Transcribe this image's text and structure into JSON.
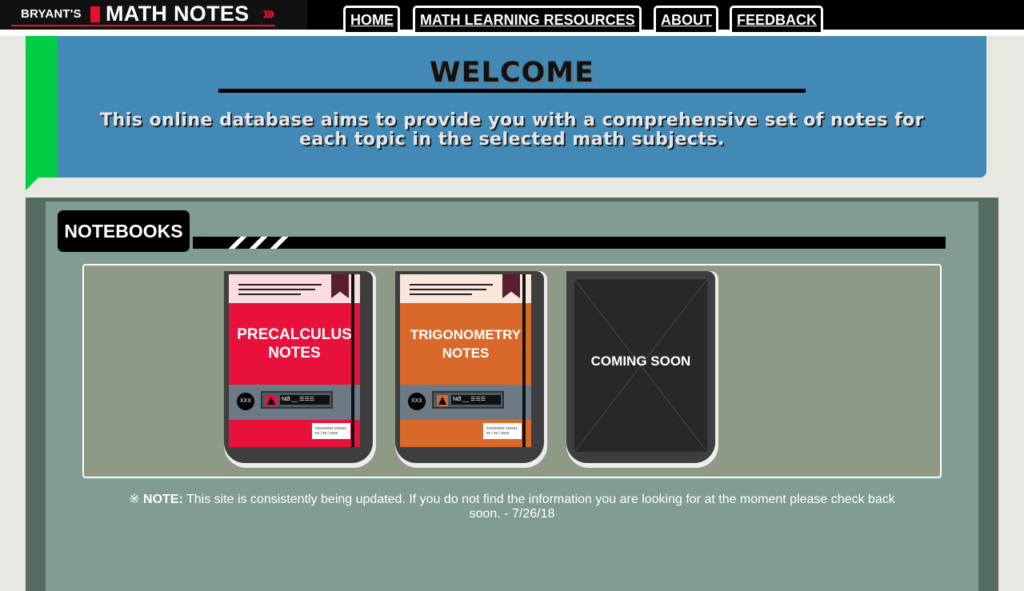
{
  "logo": {
    "prefix": "BRYANT'S",
    "name": "MATH NOTES",
    "chevrons": "›››"
  },
  "nav": [
    {
      "label": "HOME"
    },
    {
      "label": "MATH LEARNING RESOURCES"
    },
    {
      "label": "ABOUT"
    },
    {
      "label": "FEEDBACK"
    }
  ],
  "welcome": {
    "title": "WELCOME",
    "text": "This online database aims to provide you with a comprehensive set of notes for each topic in the selected math subjects."
  },
  "notebooks": {
    "heading": "NOTEBOOKS",
    "books": [
      {
        "title_line1": "PRECALCULUS",
        "title_line2": "NOTES",
        "color": "#e8113b",
        "band_color": "#fbdde1",
        "tag_text": "NØ.__ ☰☰☰",
        "circle_text": "XXX",
        "sticker_text": "xxxxxxxxx xxxxxx xx / xx / xxxx"
      },
      {
        "title_line1": "TRIGONOMETRY",
        "title_line2": "NOTES",
        "color": "#d9682b",
        "band_color": "#f9e7dc",
        "tag_text": "NØ.__ ☰☰☰",
        "circle_text": "XXX",
        "sticker_text": "xxxxxxxxx xxxxxx xx / xx / xxxx"
      }
    ],
    "coming_soon": "COMING SOON"
  },
  "note": {
    "symbol": "※",
    "label": "NOTE:",
    "text": "This site is consistently being updated. If you do not find the information you are looking for at the moment please check back soon. - 7/26/18"
  },
  "colors": {
    "accent_red": "#e8112d",
    "welcome_blue": "#428ab5",
    "green": "#00cc44",
    "panel_dark": "#566b62",
    "panel_light": "#819c93",
    "shelf": "#8f9a86"
  }
}
